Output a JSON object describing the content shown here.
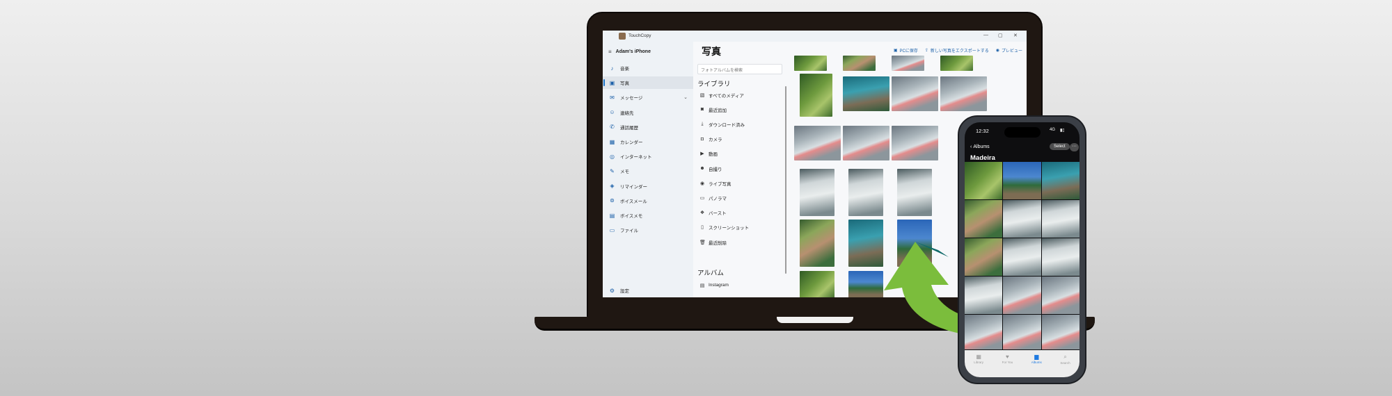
{
  "app": {
    "title": "TouchCopy",
    "device_name": "Adam's iPhone",
    "window_controls": [
      "—",
      "▢",
      "✕"
    ]
  },
  "sidebar": {
    "items": [
      {
        "label": "音楽",
        "icon": "music-note-icon"
      },
      {
        "label": "写真",
        "icon": "photo-icon",
        "active": true
      },
      {
        "label": "メッセージ",
        "icon": "message-icon",
        "expandable": true
      },
      {
        "label": "連絡先",
        "icon": "contact-icon"
      },
      {
        "label": "通話履歴",
        "icon": "phone-icon"
      },
      {
        "label": "カレンダー",
        "icon": "calendar-icon"
      },
      {
        "label": "インターネット",
        "icon": "globe-icon"
      },
      {
        "label": "メモ",
        "icon": "note-icon"
      },
      {
        "label": "リマインダー",
        "icon": "reminder-icon"
      },
      {
        "label": "ボイスメール",
        "icon": "voicemail-icon"
      },
      {
        "label": "ボイスメモ",
        "icon": "voice-memo-icon"
      },
      {
        "label": "ファイル",
        "icon": "folder-icon"
      }
    ],
    "settings_label": "設定"
  },
  "main": {
    "title": "写真",
    "toolbar": {
      "save_to_pc": "PCに保存",
      "export_new": "新しい写真をエクスポートする",
      "preview": "プレビュー"
    },
    "search": {
      "placeholder": "フォトアルバムを検索"
    },
    "library_heading": "ライブラリ",
    "library_items": [
      {
        "label": "すべてのメディア",
        "icon": "all-media-icon"
      },
      {
        "label": "最近追加",
        "icon": "recent-add-icon"
      },
      {
        "label": "ダウンロード済み",
        "icon": "download-icon"
      },
      {
        "label": "カメラ",
        "icon": "camera-icon"
      },
      {
        "label": "動画",
        "icon": "video-icon"
      },
      {
        "label": "自撮り",
        "icon": "selfie-icon"
      },
      {
        "label": "ライブ写真",
        "icon": "live-photo-icon"
      },
      {
        "label": "パノラマ",
        "icon": "panorama-icon"
      },
      {
        "label": "バースト",
        "icon": "burst-icon"
      },
      {
        "label": "スクリーンショット",
        "icon": "screenshot-icon"
      },
      {
        "label": "最近削除",
        "icon": "trash-icon"
      }
    ],
    "albums_heading": "アルバム",
    "album_items": [
      {
        "label": "Instagram",
        "icon": "album-icon"
      }
    ]
  },
  "phone": {
    "time": "12:32",
    "signal": "4G",
    "back_label": "Albums",
    "select_label": "Select",
    "more_label": "···",
    "album_title": "Madeira",
    "tabs": [
      {
        "label": "Library",
        "icon": "library-icon"
      },
      {
        "label": "For You",
        "icon": "for-you-icon"
      },
      {
        "label": "Albums",
        "icon": "albums-icon",
        "active": true
      },
      {
        "label": "Search",
        "icon": "search-icon"
      }
    ]
  },
  "colors": {
    "accent": "#1a5fa8",
    "arrow_green": "#7bbd3c",
    "arrow_teal": "#116b6a",
    "laptop_body": "#1f1712"
  }
}
